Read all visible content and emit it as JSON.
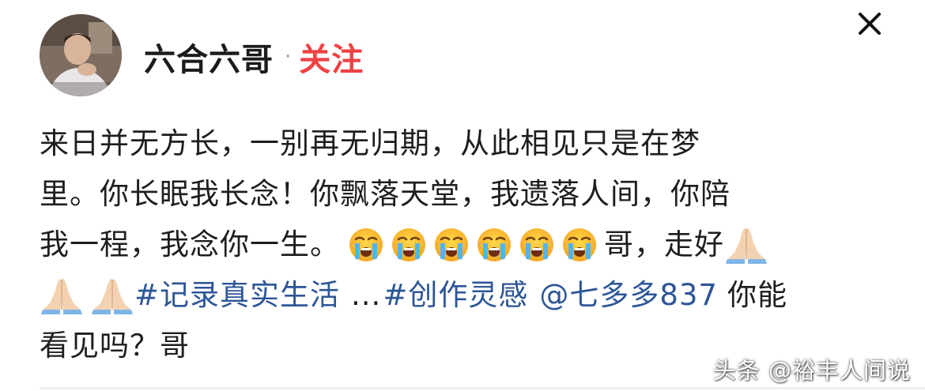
{
  "header": {
    "username": "六合六哥",
    "separator": "·",
    "follow_label": "关注"
  },
  "post": {
    "line1": "来日并无方长，一别再无归期，从此相见只是在梦",
    "line2": "里。你长眠我长念！你飘落天堂，我遗落人间，你陪",
    "line3_text": "我一程，我念你一生。",
    "line3_after": "哥，走好",
    "tag1": "#记录真实生活",
    "ellipsis": "...",
    "tag2": "#创作灵感",
    "mention": "@七多多837",
    "line4_after": "你能",
    "line5": "看见吗？哥"
  },
  "icons": {
    "crying_emoji_count": 6,
    "praying_hands_count": 3,
    "close": "close-icon"
  },
  "watermark": "头条 @裕丰人间说",
  "colors": {
    "follow": "#f04142",
    "link": "#2c5697",
    "text": "#1e1e1e"
  }
}
